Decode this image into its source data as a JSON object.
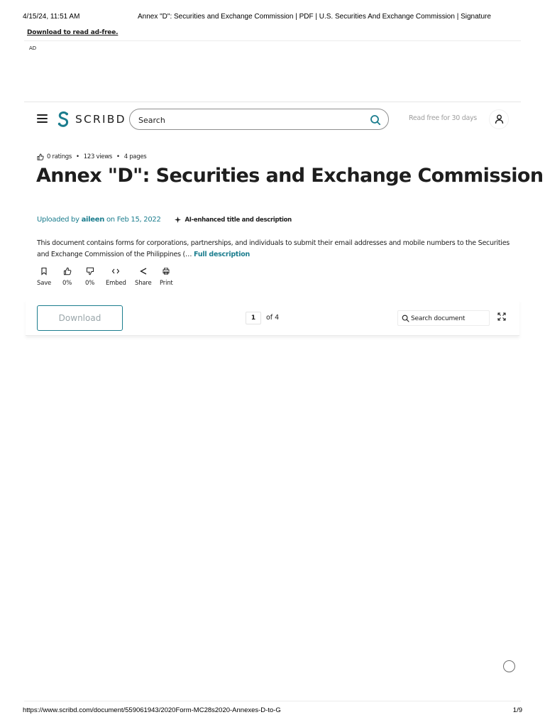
{
  "print_header": {
    "date": "4/15/24, 11:51 AM",
    "title": "Annex \"D\": Securities and Exchange Commission | PDF | U.S. Securities And Exchange Commission | Signature"
  },
  "ad": {
    "ad_free_link": "Download to read ad-free.",
    "label": "AD"
  },
  "navbar": {
    "logo_text": "SCRIBD",
    "search_placeholder": "Search",
    "read_free": "Read free for 30 days",
    "brand_color": "#1b7d8e"
  },
  "document": {
    "ratings": "0 ratings",
    "views": "123 views",
    "pages": "4 pages",
    "title": "Annex \"D\": Securities and Exchange Commission",
    "uploaded_by_prefix": "Uploaded by",
    "uploader": "aileen",
    "upload_date": "on Feb 15, 2022",
    "ai_badge": "AI-enhanced title and description",
    "description": "This document contains forms for corporations, partnerships, and individuals to submit their email addresses and mobile numbers to the Securities and Exchange Commission of the Philippines (…",
    "full_description_link": "Full description"
  },
  "actions": [
    {
      "icon": "bookmark-icon",
      "label": "Save"
    },
    {
      "icon": "thumbs-up-icon",
      "label": "0%"
    },
    {
      "icon": "thumbs-down-icon",
      "label": "0%"
    },
    {
      "icon": "code-icon",
      "label": "Embed"
    },
    {
      "icon": "share-icon",
      "label": "Share"
    },
    {
      "icon": "print-icon",
      "label": "Print"
    }
  ],
  "toolbar": {
    "download_label": "Download",
    "current_page": "1",
    "page_of": "of 4",
    "search_doc_placeholder": "Search document"
  },
  "print_footer": {
    "url": "https://www.scribd.com/document/559061943/2020Form-MC28s2020-Annexes-D-to-G",
    "page": "1/9"
  }
}
